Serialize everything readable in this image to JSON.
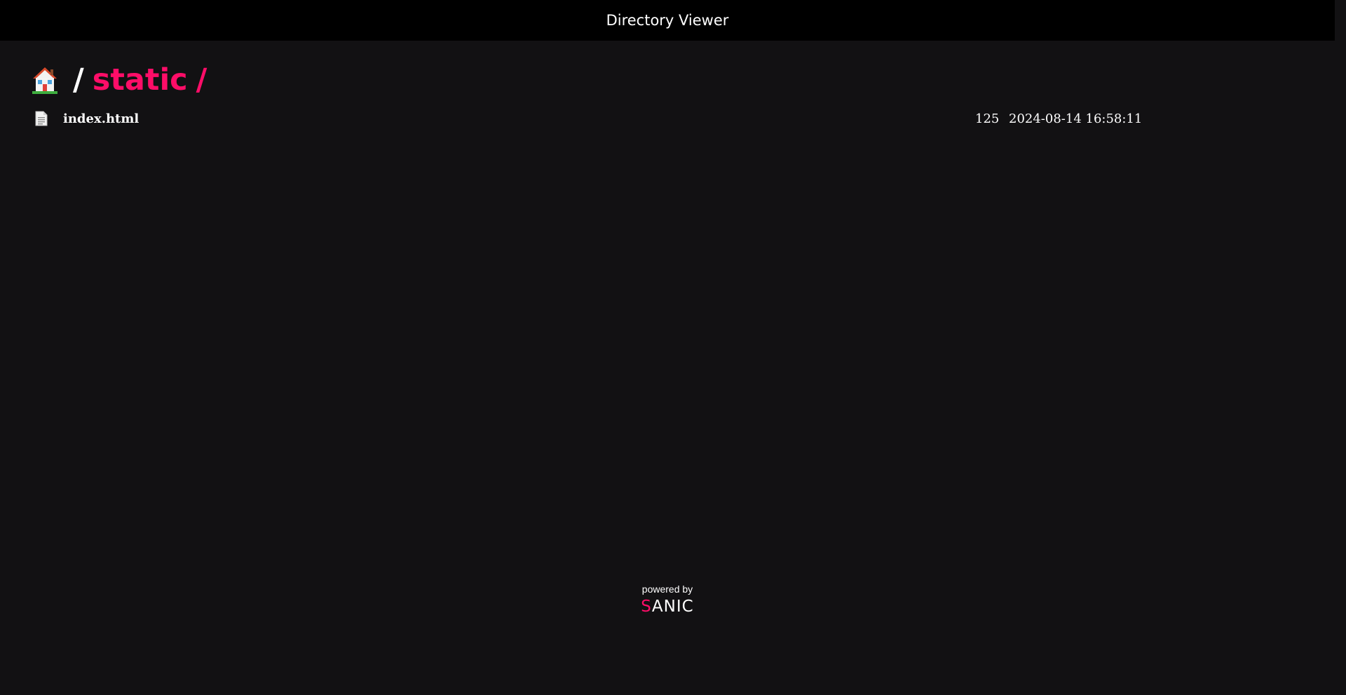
{
  "header": {
    "title": "Directory Viewer"
  },
  "breadcrumb": {
    "home_icon": "house-icon",
    "separator": "/",
    "current": "static",
    "trailing_separator": "/",
    "accent_color": "#ff0d68"
  },
  "files": [
    {
      "icon": "document-icon",
      "name": "index.html",
      "size": "125",
      "modified": "2024-08-14 16:58:11"
    }
  ],
  "footer": {
    "caption": "powered by",
    "logo_letter": "S",
    "logo_rest": "ANIC"
  },
  "colors": {
    "background": "#121113",
    "header_bg": "#000000",
    "text": "#ffffff",
    "accent": "#ff0d68"
  }
}
